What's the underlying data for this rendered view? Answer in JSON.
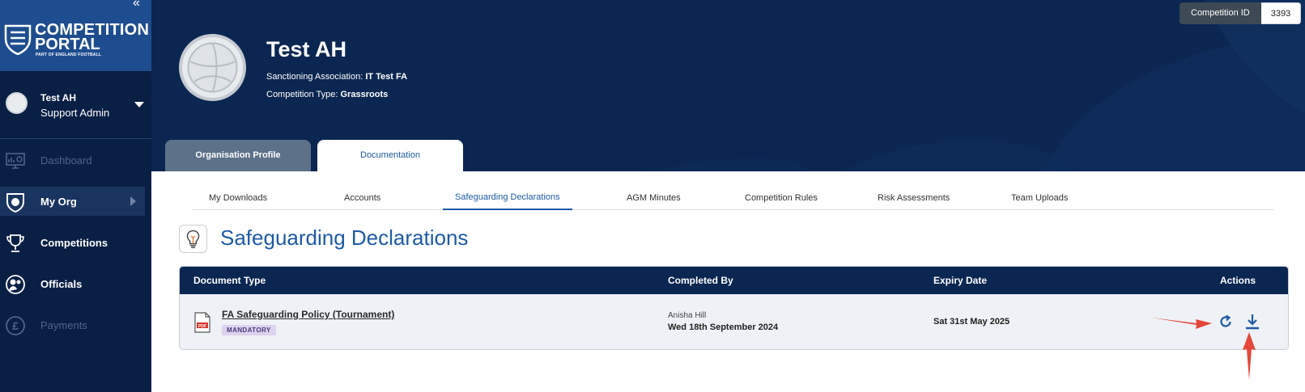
{
  "sidebar": {
    "collapse_glyph": "«",
    "logo": {
      "line1": "COMPETITION",
      "line2": "PORTAL",
      "tagline": "PART OF ENGLAND FOOTBALL"
    },
    "user": {
      "name": "Test AH",
      "role": "Support Admin"
    },
    "nav": [
      {
        "label": "Dashboard",
        "icon": "dashboard-icon",
        "state": "disabled"
      },
      {
        "label": "My Org",
        "icon": "shield-icon",
        "state": "active"
      },
      {
        "label": "Competitions",
        "icon": "trophy-icon",
        "state": "normal"
      },
      {
        "label": "Officials",
        "icon": "whistle-icon",
        "state": "normal"
      },
      {
        "label": "Payments",
        "icon": "pound-icon",
        "state": "disabled"
      }
    ]
  },
  "header": {
    "org_name": "Test AH",
    "sanctioning_label": "Sanctioning Association:",
    "sanctioning_value": "IT Test FA",
    "type_label": "Competition Type:",
    "type_value": "Grassroots",
    "competition_id_label": "Competition ID",
    "competition_id_value": "3393",
    "tabs": [
      {
        "label": "Organisation Profile",
        "active": false
      },
      {
        "label": "Documentation",
        "active": true
      }
    ]
  },
  "subtabs": [
    {
      "label": "My Downloads",
      "active": false
    },
    {
      "label": "Accounts",
      "active": false
    },
    {
      "label": "Safeguarding Declarations",
      "active": true
    },
    {
      "label": "AGM Minutes",
      "active": false
    },
    {
      "label": "Competition Rules",
      "active": false
    },
    {
      "label": "Risk Assessments",
      "active": false
    },
    {
      "label": "Team Uploads",
      "active": false
    }
  ],
  "section": {
    "title": "Safeguarding Declarations",
    "icon": "lightbulb-icon"
  },
  "table": {
    "columns": [
      "Document Type",
      "Completed By",
      "Expiry Date",
      "Actions"
    ],
    "rows": [
      {
        "document": "FA Safeguarding Policy (Tournament)",
        "badge": "MANDATORY",
        "pdf_label": "PDF",
        "completed_by_name": "Anisha Hill",
        "completed_by_date": "Wed 18th September 2024",
        "expiry": "Sat 31st May 2025",
        "actions": [
          "renew-icon",
          "download-icon"
        ]
      }
    ]
  },
  "colors": {
    "navy": "#0b2650",
    "sidebar": "#0a1f44",
    "logo_bg": "#1e4d8f",
    "accent_blue": "#1e5aa6",
    "annotation_red": "#e5473a",
    "badge_bg": "#dcd3ee"
  }
}
